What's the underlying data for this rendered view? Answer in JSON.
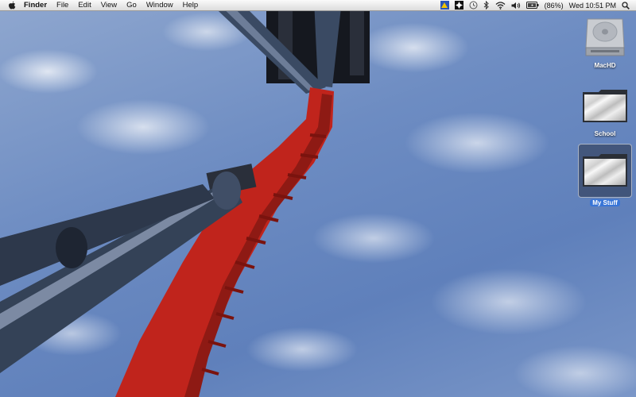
{
  "menubar": {
    "app_name": "Finder",
    "menus": [
      "File",
      "Edit",
      "View",
      "Go",
      "Window",
      "Help"
    ],
    "battery_percent": "(86%)",
    "clock": "Wed 10:51 PM"
  },
  "desktop": {
    "icons": [
      {
        "label": "MacHD",
        "kind": "hard-drive",
        "selected": false
      },
      {
        "label": "School",
        "kind": "folder",
        "selected": false
      },
      {
        "label": "My Stuff",
        "kind": "folder",
        "selected": true
      }
    ]
  },
  "colors": {
    "track_red": "#c0241c",
    "pillar_blue": "#3a4a63",
    "selection_blue": "#3875d7"
  }
}
